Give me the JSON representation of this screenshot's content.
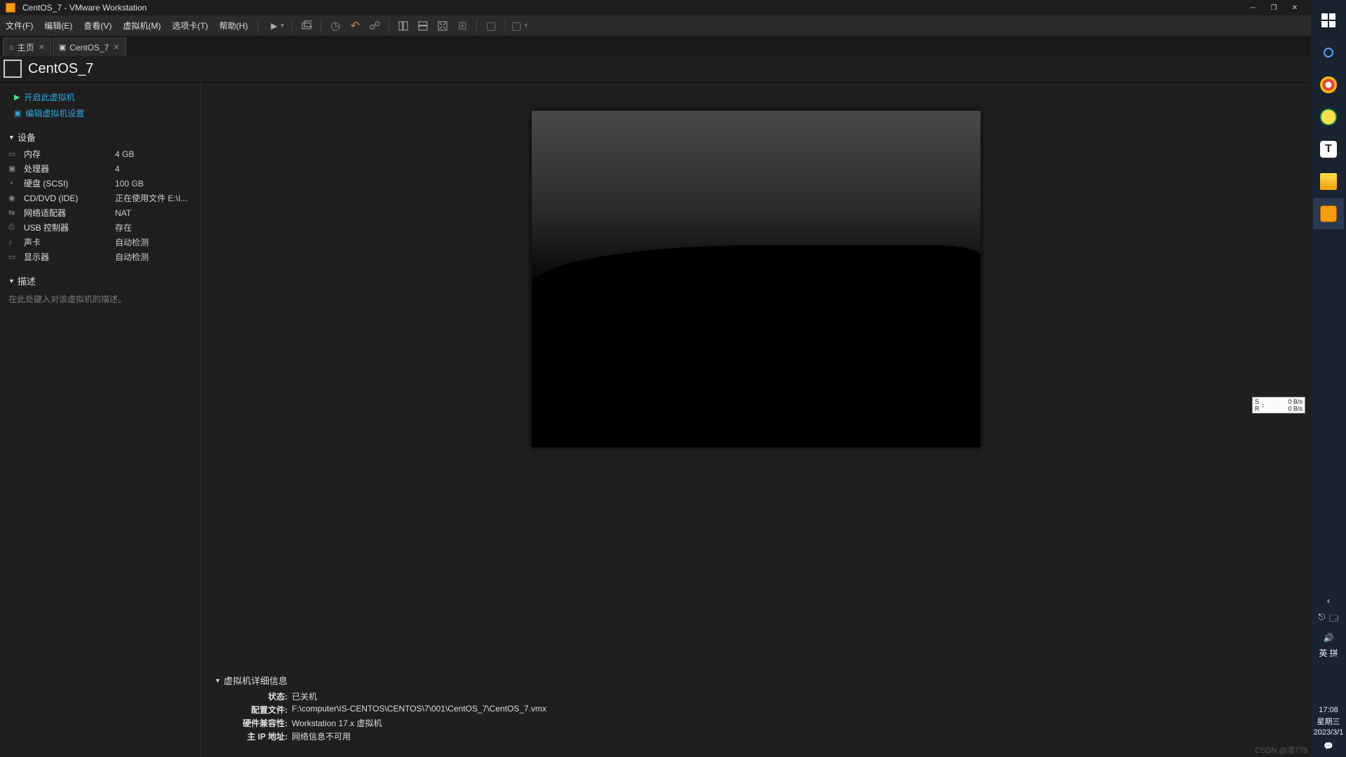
{
  "titlebar": {
    "title": "CentOS_7 - VMware Workstation"
  },
  "menu": {
    "items": [
      "文件(F)",
      "编辑(E)",
      "查看(V)",
      "虚拟机(M)",
      "选项卡(T)",
      "帮助(H)"
    ]
  },
  "tabs": {
    "home": "主页",
    "vm": "CentOS_7"
  },
  "vm": {
    "title": "CentOS_7"
  },
  "actions": {
    "power_on": "开启此虚拟机",
    "edit_settings": "编辑虚拟机设置"
  },
  "sections": {
    "devices": "设备",
    "description": "描述"
  },
  "devices": [
    {
      "icon": "▭",
      "name": "内存",
      "value": "4 GB"
    },
    {
      "icon": "▣",
      "name": "处理器",
      "value": "4"
    },
    {
      "icon": "◔",
      "name": "硬盘 (SCSI)",
      "value": "100 GB"
    },
    {
      "icon": "◉",
      "name": "CD/DVD (IDE)",
      "value": "正在使用文件 E:\\I..."
    },
    {
      "icon": "⇆",
      "name": "网络适配器",
      "value": "NAT"
    },
    {
      "icon": "⎙",
      "name": "USB 控制器",
      "value": "存在"
    },
    {
      "icon": "♪",
      "name": "声卡",
      "value": "自动检测"
    },
    {
      "icon": "▭",
      "name": "显示器",
      "value": "自动检测"
    }
  ],
  "description_placeholder": "在此处键入对该虚拟机的描述。",
  "details": {
    "header": "虚拟机详细信息",
    "rows": [
      {
        "label": "状态:",
        "value": "已关机"
      },
      {
        "label": "配置文件:",
        "value": "F:\\computer\\IS-CENTOS\\CENTOS\\7\\001\\CentOS_7\\CentOS_7.vmx"
      },
      {
        "label": "硬件兼容性:",
        "value": "Workstation 17.x 虚拟机"
      },
      {
        "label": "主 IP 地址:",
        "value": "网络信息不可用"
      }
    ]
  },
  "net_widget": {
    "s": "S",
    "r": "R",
    "arrow": "↕",
    "s_val": "0 B/s",
    "r_val": "0 B/s"
  },
  "taskbar": {
    "ime1": "英",
    "ime2": "拼",
    "time": "17:08",
    "weekday": "星期三",
    "date": "2023/3/1"
  },
  "csdn": "CSDN @凌775"
}
